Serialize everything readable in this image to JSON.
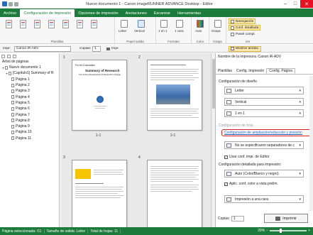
{
  "window": {
    "title": "Nuevo documento 1 - Canon imageRUNNER ADVANCE Desktop - Editor",
    "minimize": "–",
    "maximize": "□",
    "close": "✕"
  },
  "menu": [
    "Archivo",
    "Configuración de impresión",
    "Opciones de impresión",
    "Anotaciones",
    "Escanear",
    "Herramientas"
  ],
  "ribbon": {
    "groups": {
      "plantillas": "Plantillas",
      "papel": "Papel salida",
      "formato": "Formato",
      "color": "Color",
      "grapa": "Grapa",
      "ver": "Ver"
    },
    "buttons": {
      "letter": "Letter",
      "vertical": "Vertical",
      "en1": "1 en 1",
      "caras": "1 cara",
      "auto": "Auto",
      "grapa": "Grapa",
      "navegacion": "Navegación",
      "conf_detallada": "Conf. detallada",
      "panel_compl": "Panel compl."
    }
  },
  "toolbar": {
    "impr_label": "Impr:",
    "printer": "Canon iR-ADV",
    "copias_label": "Copias:",
    "copias": "1",
    "impr_btn": "Impr.",
    "mostrar": "Mostrar anotac."
  },
  "left_pane": {
    "header": "Árbol de páginas",
    "root": "Nuevo documento 1",
    "chapter": "[Capítulo1] Summary of R",
    "pages": [
      "Página 1",
      "Página 2",
      "Página 3",
      "Página 4",
      "Página 5",
      "Página 6",
      "Página 7",
      "Página 8",
      "Página 9",
      "Página 10",
      "Página 11"
    ]
  },
  "preview": {
    "group_numbers": [
      "1",
      "2",
      "3",
      "4"
    ],
    "page_labels": [
      "1-1",
      "2-1"
    ],
    "page1_title": "Summary of Research",
    "page1_org": "For Art Corporation",
    "page1_subtitle": "The Future Development of Research in Design"
  },
  "right_pane": {
    "printer_label": "Nombre de la impresora: Canon iR-ADV",
    "tabs": [
      "Plantillas",
      "Config. Impresión",
      "Config. Página"
    ],
    "diseno_label": "Configuración de diseño",
    "paper": "Letter",
    "orientation": "Vertical",
    "layout": "1 en 1",
    "partial_section": "Configuración de hoja",
    "link": "Configuración de ampliación/reducción y posición",
    "separator": "No se especificaron separadores de c",
    "user_conf": "Usar conf. impr. de Editor",
    "detailed_label": "Configuración detallada para impresión:",
    "color_mode": "Auto (Color/Blanco y negro)",
    "aplic": "Aplic. conf. color a vista prelim.",
    "duplex": "Impresión a una cara",
    "copias_label": "Copias:",
    "copias": "1",
    "print_btn": "Imprimir"
  },
  "status": {
    "selected": "Página seleccionada: /11",
    "size": "Tamaño de salida: Letter",
    "total": "Total de hojas: 11",
    "zoom": "29%"
  }
}
